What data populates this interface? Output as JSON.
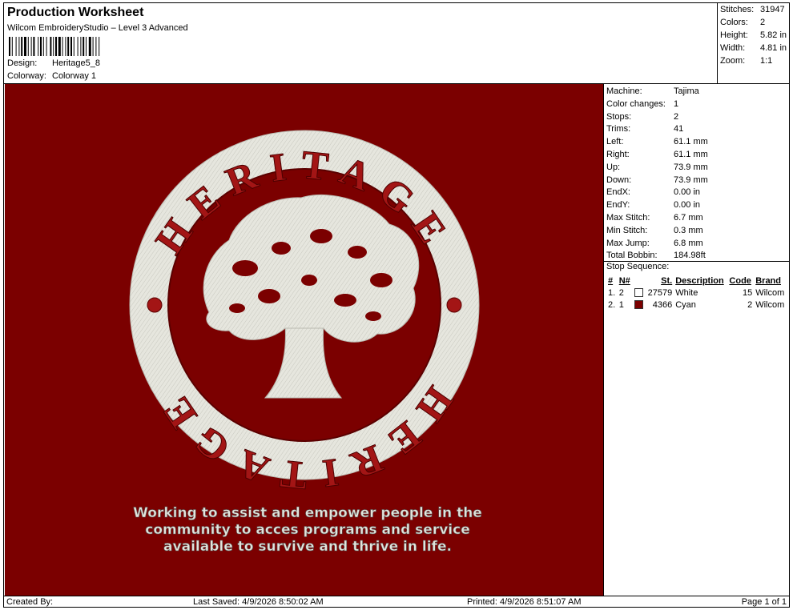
{
  "header": {
    "title": "Production Worksheet",
    "subtitle": "Wilcom EmbroideryStudio – Level 3 Advanced",
    "design_label": "Design:",
    "design_value": "Heritage5_8",
    "colorway_label": "Colorway:",
    "colorway_value": "Colorway 1"
  },
  "stats": {
    "stitches_label": "Stitches:",
    "stitches": "31947",
    "colors_label": "Colors:",
    "colors": "2",
    "height_label": "Height:",
    "height": "5.82 in",
    "width_label": "Width:",
    "width": "4.81 in",
    "zoom_label": "Zoom:",
    "zoom": "1:1"
  },
  "design": {
    "ring_text": "HERITAGE",
    "slogan_line1": "Working to assist and empower people in the",
    "slogan_line2": "community to acces programs and service",
    "slogan_line3": "available to survive and thrive in life.",
    "background_color": "#7b0000",
    "thread_color": "#e4e4dc"
  },
  "machine_info": [
    {
      "label": "Machine:",
      "value": "Tajima"
    },
    {
      "label": "Color changes:",
      "value": "1"
    },
    {
      "label": "Stops:",
      "value": "2"
    },
    {
      "label": "Trims:",
      "value": "41"
    },
    {
      "label": "Left:",
      "value": "61.1 mm"
    },
    {
      "label": "Right:",
      "value": "61.1 mm"
    },
    {
      "label": "Up:",
      "value": "73.9 mm"
    },
    {
      "label": "Down:",
      "value": "73.9 mm"
    },
    {
      "label": "EndX:",
      "value": "0.00 in"
    },
    {
      "label": "EndY:",
      "value": "0.00 in"
    },
    {
      "label": "Max Stitch:",
      "value": "6.7 mm"
    },
    {
      "label": "Min Stitch:",
      "value": "0.3 mm"
    },
    {
      "label": "Max Jump:",
      "value": "6.8 mm"
    },
    {
      "label": "Total Bobbin:",
      "value": "184.98ft"
    }
  ],
  "stop_sequence": {
    "title": "Stop Sequence:",
    "headers": {
      "num": "#",
      "n": "N#",
      "st": "St.",
      "desc": "Description",
      "code": "Code",
      "brand": "Brand"
    },
    "rows": [
      {
        "num": "1.",
        "n": "2",
        "swatch": "#ffffff",
        "st": "27579",
        "desc": "White",
        "code": "15",
        "brand": "Wilcom"
      },
      {
        "num": "2.",
        "n": "1",
        "swatch": "#7b0000",
        "st": "4366",
        "desc": "Cyan",
        "code": "2",
        "brand": "Wilcom"
      }
    ]
  },
  "footer": {
    "created_by": "Created By:",
    "last_saved": "Last Saved: 4/9/2026 8:50:02 AM",
    "printed": "Printed: 4/9/2026 8:51:07 AM",
    "page": "Page 1 of 1"
  }
}
